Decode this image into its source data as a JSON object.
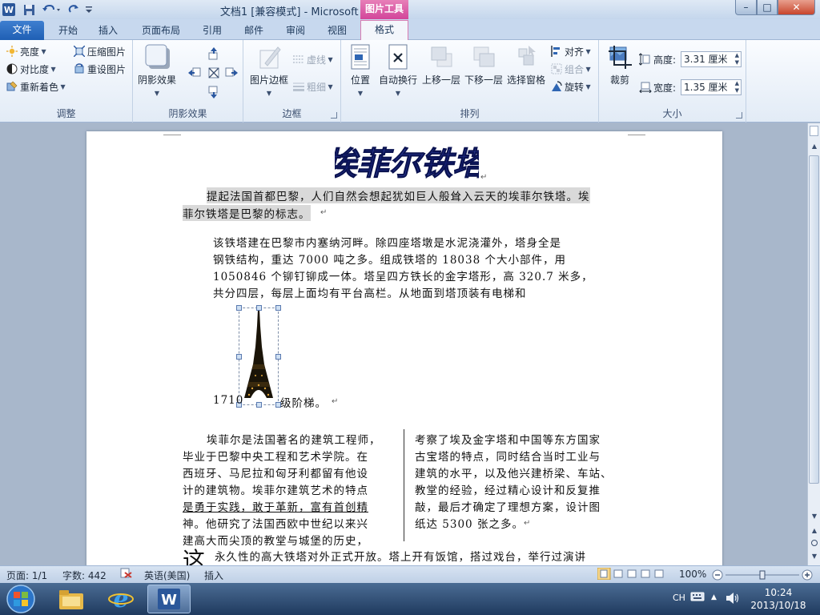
{
  "window": {
    "title": "文档1 [兼容模式] - Microsoft Word",
    "context_tab_group": "图片工具",
    "minimize": "–",
    "maximize": "□",
    "close": "✕"
  },
  "ribbon_tabs": [
    "文件",
    "开始",
    "插入",
    "页面布局",
    "引用",
    "邮件",
    "审阅",
    "视图",
    "格式"
  ],
  "active_tab": "格式",
  "ribbon": {
    "adjust": {
      "label": "调整",
      "brightness": "亮度",
      "contrast": "对比度",
      "recolor": "重新着色",
      "compress": "压缩图片",
      "reset": "重设图片"
    },
    "shadow": {
      "label": "阴影效果",
      "shadow_effects": "阴影效果"
    },
    "border": {
      "label": "边框",
      "picture_border": "图片边框",
      "dashes": "虚线",
      "weight": "粗细"
    },
    "arrange": {
      "label": "排列",
      "position": "位置",
      "wrap_text": "自动换行",
      "bring_forward": "上移一层",
      "send_backward": "下移一层",
      "selection_pane": "选择窗格",
      "align": "对齐",
      "group": "组合",
      "rotate": "旋转"
    },
    "size": {
      "label": "大小",
      "crop": "裁剪",
      "height_label": "高度:",
      "height_value": "3.31 厘米",
      "width_label": "宽度:",
      "width_value": "1.35 厘米"
    }
  },
  "document": {
    "wordart_title": "埃菲尔铁塔",
    "para1_line1": "提起法国首都巴黎，人们自然会想起犹如巨人般耸入云天的埃菲尔铁塔。埃",
    "para1_line2": "菲尔铁塔是巴黎的标志。",
    "para2_lines": [
      "该铁塔建在巴黎市内塞纳河畔。除四座塔墩是水泥浇灌外，塔身全是",
      "钢铁结构，重达 7000 吨之多。组成铁塔的 18038 个大小部件，用",
      "1050846 个铆钉铆成一体。塔呈四方铁长的金字塔形，高 320.7 米多，",
      "共分四层，每层上面均有平台高栏。从地面到塔顶装有电梯和"
    ],
    "para2_tail_before": "1710",
    "para2_tail_after": "级阶梯。",
    "col_left": [
      "埃菲尔是法国著名的建筑工程师，",
      "毕业于巴黎中央工程和艺术学院。在",
      "西班牙、马尼拉和匈牙利都留有他设",
      "计的建筑物。埃菲尔建筑艺术的特点",
      "是勇于实践，敢于革新，富有首创精",
      "神。他研究了法国西欧中世纪以来兴",
      "建高大而尖顶的教堂与城堡的历史，"
    ],
    "col_right": [
      "考察了埃及金字塔和中国等东方国家",
      "古宝塔的特点，同时结合当时工业与",
      "建筑的水平，以及他兴建桥梁、车站、",
      "教堂的经验，经过精心设计和反复推",
      "敲，最后才确定了理想方案，设计图",
      "纸达 5300 张之多。"
    ],
    "dropcap": "这",
    "last_line": "永久性的高大铁塔对外正式开放。塔上开有饭馆，搭过戏台，举行过演讲"
  },
  "status": {
    "page": "页面: 1/1",
    "words": "字数: 442",
    "language": "英语(美国)",
    "mode": "插入",
    "zoom": "100%"
  },
  "taskbar": {
    "ime": "CH",
    "time": "10:24",
    "date": "2013/10/18"
  },
  "colors": {
    "file_tab": "#2a6cc2",
    "context_tab": "#d85aa5",
    "wordart_fill": "#1f2f8a"
  },
  "icons": [
    "word-app-icon",
    "save-icon",
    "undo-icon",
    "redo-icon",
    "brightness-icon",
    "contrast-icon",
    "recolor-icon",
    "compress-icon",
    "reset-picture-icon",
    "shadow-icon",
    "picture-border-icon",
    "position-icon",
    "wrap-text-icon",
    "crop-icon",
    "start-orb-icon",
    "explorer-icon",
    "ie-icon"
  ]
}
